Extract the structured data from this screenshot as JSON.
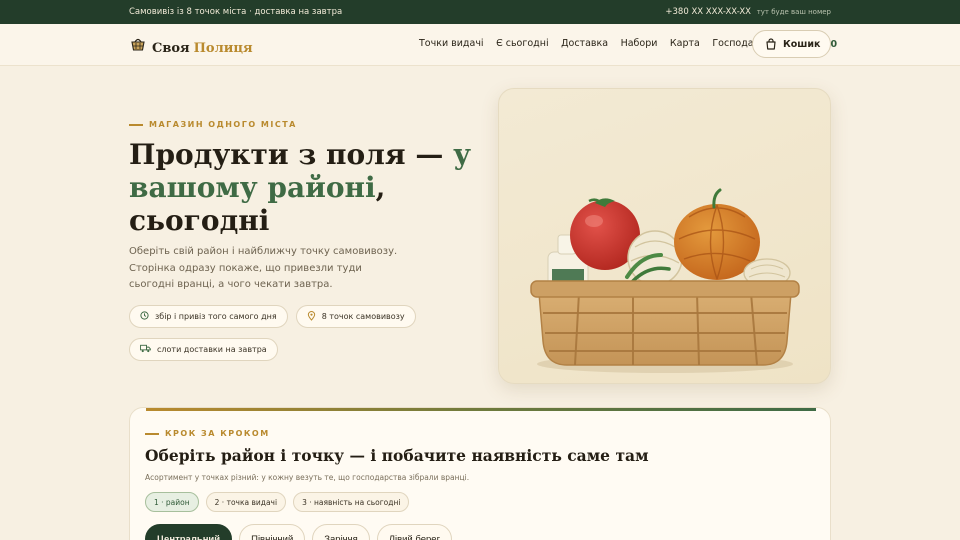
{
  "topbar": {
    "left_text": "Самовивіз із 8 точок міста · доставка на завтра",
    "phone": "+380 XX XXX-XX-XX",
    "phone_note": "тут буде ваш номер"
  },
  "header": {
    "logo_word1": "Своя",
    "logo_word2": "Полиця",
    "logo_icon": "basket-icon",
    "nav": [
      "Точки видачі",
      "Є сьогодні",
      "Доставка",
      "Набори",
      "Карта",
      "Господарства"
    ],
    "cart_label": "Кошик",
    "cart_count": "0",
    "cart_icon": "bag-icon"
  },
  "hero": {
    "eyebrow": "МАГАЗИН ОДНОГО МІСТА",
    "title_part1": "Продукти з поля — ",
    "title_green": "у вашому районі",
    "title_part2": ", сьогодні",
    "subtitle": "Оберіть свій район і найближчу точку самовивозу. Сторінка одразу покаже, що привезли туди сьогодні вранці, а чого чекати завтра.",
    "chips": [
      {
        "icon": "clock-icon",
        "label": "збір і привіз того самого дня"
      },
      {
        "icon": "pin-icon",
        "label": "8 точок самовивозу"
      },
      {
        "icon": "truck-icon",
        "label": "слоти доставки на завтра"
      }
    ]
  },
  "panel": {
    "eyebrow": "КРОК ЗА КРОКОМ",
    "title": "Оберіть район і точку — і побачите наявність саме там",
    "subtitle": "Асортимент у точках різний: у кожну везуть те, що господарства зібрали вранці.",
    "steps": [
      "1 · район",
      "2 · точка видачі",
      "3 · наявність на сьогодні"
    ],
    "active_step": 0,
    "districts": [
      "Центральний",
      "Північний",
      "Заріччя",
      "Лівий берег"
    ],
    "active_district": 0
  },
  "colors": {
    "background": "#f7f0e2",
    "topbar": "#233d2a",
    "accent_gold": "#b98a2e",
    "accent_green": "#3f6b45"
  }
}
